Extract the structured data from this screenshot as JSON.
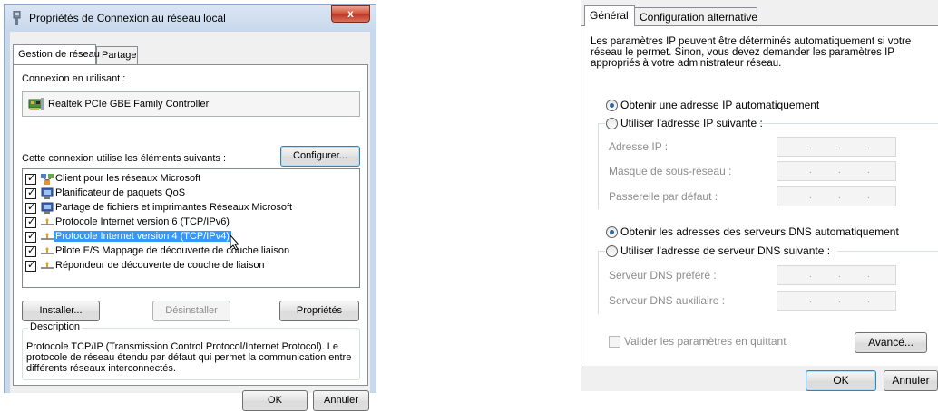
{
  "left_dialog": {
    "title": "Propriétés de Connexion au réseau local",
    "close_glyph": "x",
    "tabs": [
      {
        "label": "Gestion de réseau",
        "active": true
      },
      {
        "label": "Partage",
        "active": false
      }
    ],
    "connect_using_label": "Connexion en utilisant :",
    "adapter_name": "Realtek PCIe GBE Family Controller",
    "configure_button": "Configurer...",
    "items_label": "Cette connexion utilise les éléments suivants :",
    "items": [
      {
        "label": "Client pour les réseaux Microsoft",
        "checked": true,
        "icon": "network-client-icon",
        "selected": false
      },
      {
        "label": "Planificateur de paquets QoS",
        "checked": true,
        "icon": "service-icon",
        "selected": false
      },
      {
        "label": "Partage de fichiers et imprimantes Réseaux Microsoft",
        "checked": true,
        "icon": "service-icon",
        "selected": false
      },
      {
        "label": "Protocole Internet version 6 (TCP/IPv6)",
        "checked": true,
        "icon": "protocol-icon",
        "selected": false
      },
      {
        "label": "Protocole Internet version 4 (TCP/IPv4)",
        "checked": true,
        "icon": "protocol-icon",
        "selected": true
      },
      {
        "label": "Pilote E/S Mappage de découverte de couche liaison",
        "checked": true,
        "icon": "protocol-icon",
        "selected": false
      },
      {
        "label": "Répondeur de découverte de couche de liaison",
        "checked": true,
        "icon": "protocol-icon",
        "selected": false
      }
    ],
    "install_button": "Installer...",
    "uninstall_button": "Désinstaller",
    "properties_button": "Propriétés",
    "description_legend": "Description",
    "description_text": "Protocole TCP/IP (Transmission Control Protocol/Internet Protocol). Le protocole de réseau étendu par défaut qui permet la communication entre différents réseaux interconnectés.",
    "ok_button": "OK",
    "cancel_button": "Annuler",
    "check_glyph": "✓"
  },
  "right_dialog": {
    "tabs": [
      {
        "label": "Général",
        "active": true
      },
      {
        "label": "Configuration alternative",
        "active": false
      }
    ],
    "intro_text": "Les paramètres IP peuvent être déterminés automatiquement si votre réseau le permet. Sinon, vous devez demander les paramètres IP appropriés à votre administrateur réseau.",
    "ip_auto_label": "Obtenir une adresse IP automatiquement",
    "ip_manual_label": "Utiliser l'adresse IP suivante :",
    "ip_address_label": "Adresse IP :",
    "subnet_mask_label": "Masque de sous-réseau :",
    "gateway_label": "Passerelle par défaut :",
    "dns_auto_label": "Obtenir les adresses des serveurs DNS automatiquement",
    "dns_manual_label": "Utiliser l'adresse de serveur DNS suivante :",
    "dns_preferred_label": "Serveur DNS préféré :",
    "dns_alternate_label": "Serveur DNS auxiliaire :",
    "validate_label": "Valider les paramètres en quittant",
    "advanced_button": "Avancé...",
    "ok_button": "OK",
    "cancel_button": "Annuler",
    "ip_dot": ".",
    "ip_auto_selected": true,
    "dns_auto_selected": true,
    "validate_checked": false
  }
}
